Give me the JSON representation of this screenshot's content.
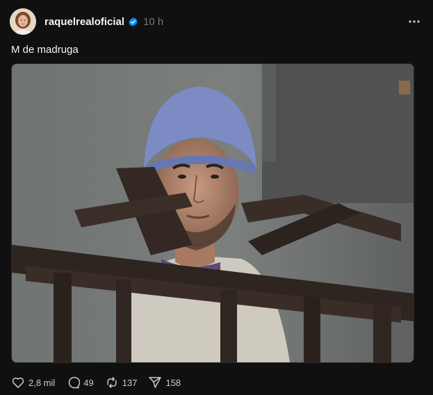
{
  "post": {
    "username": "raquelrealoficial",
    "timestamp": "10 h",
    "caption": "M de madruga",
    "verified_color": "#0095f6"
  },
  "actions": {
    "like_count": "2,8 mil",
    "comment_count": "49",
    "repost_count": "137",
    "share_count": "158"
  },
  "icons": [
    "verified-badge-icon",
    "more-options-icon",
    "heart-icon",
    "comment-icon",
    "repost-icon",
    "share-icon"
  ]
}
